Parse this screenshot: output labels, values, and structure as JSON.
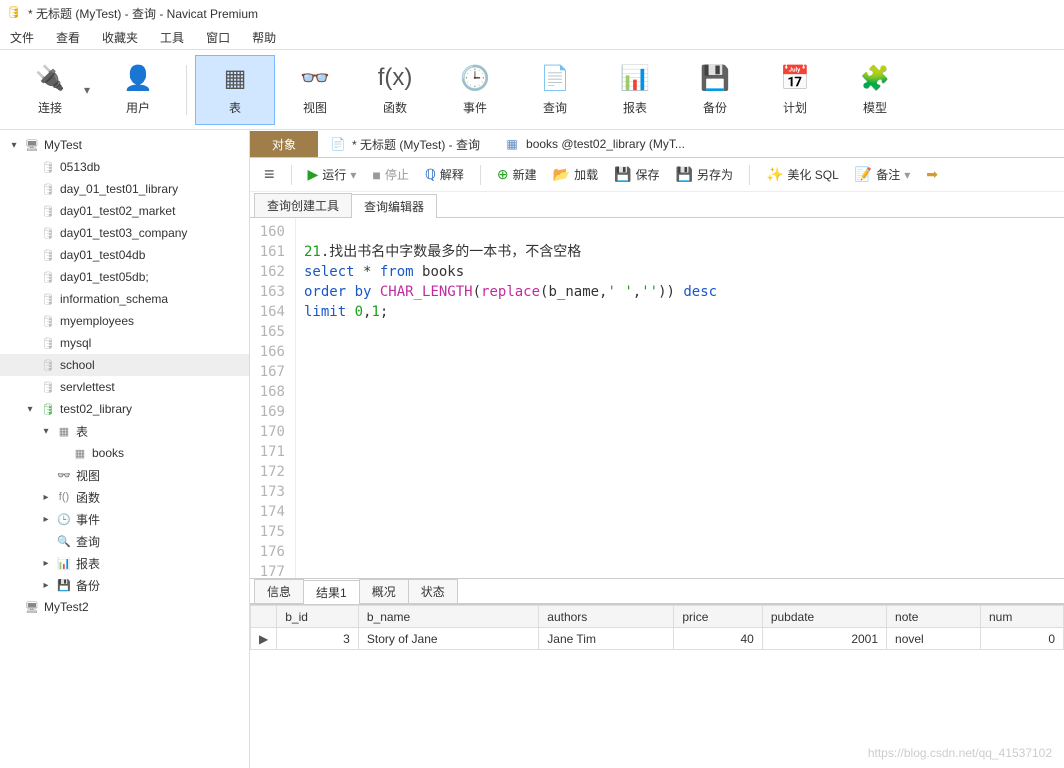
{
  "window": {
    "title": "* 无标题 (MyTest) - 查询 - Navicat Premium"
  },
  "menu": [
    "文件",
    "查看",
    "收藏夹",
    "工具",
    "窗口",
    "帮助"
  ],
  "toolbar": [
    {
      "id": "connect",
      "label": "连接",
      "glyph": "🔌"
    },
    {
      "id": "user",
      "label": "用户",
      "glyph": "👤"
    },
    {
      "id": "table",
      "label": "表",
      "glyph": "▦",
      "selected": true
    },
    {
      "id": "view",
      "label": "视图",
      "glyph": "👓"
    },
    {
      "id": "func",
      "label": "函数",
      "glyph": "f(x)"
    },
    {
      "id": "event",
      "label": "事件",
      "glyph": "🕒"
    },
    {
      "id": "query",
      "label": "查询",
      "glyph": "📄"
    },
    {
      "id": "report",
      "label": "报表",
      "glyph": "📊"
    },
    {
      "id": "backup",
      "label": "备份",
      "glyph": "💾"
    },
    {
      "id": "schedule",
      "label": "计划",
      "glyph": "📅"
    },
    {
      "id": "model",
      "label": "模型",
      "glyph": "🧩"
    }
  ],
  "tree": [
    {
      "depth": 0,
      "arrow": "▾",
      "icon": "🖥",
      "label": "MyTest",
      "cls": ""
    },
    {
      "depth": 1,
      "arrow": "",
      "icon": "db",
      "label": "0513db"
    },
    {
      "depth": 1,
      "arrow": "",
      "icon": "db",
      "label": "day_01_test01_library"
    },
    {
      "depth": 1,
      "arrow": "",
      "icon": "db",
      "label": "day01_test02_market"
    },
    {
      "depth": 1,
      "arrow": "",
      "icon": "db",
      "label": "day01_test03_company"
    },
    {
      "depth": 1,
      "arrow": "",
      "icon": "db",
      "label": "day01_test04db"
    },
    {
      "depth": 1,
      "arrow": "",
      "icon": "db",
      "label": "day01_test05db;"
    },
    {
      "depth": 1,
      "arrow": "",
      "icon": "db",
      "label": "information_schema"
    },
    {
      "depth": 1,
      "arrow": "",
      "icon": "db",
      "label": "myemployees"
    },
    {
      "depth": 1,
      "arrow": "",
      "icon": "db",
      "label": "mysql"
    },
    {
      "depth": 1,
      "arrow": "",
      "icon": "db",
      "label": "school",
      "sel": true
    },
    {
      "depth": 1,
      "arrow": "",
      "icon": "db",
      "label": "servlettest"
    },
    {
      "depth": 1,
      "arrow": "▾",
      "icon": "db-on",
      "label": "test02_library"
    },
    {
      "depth": 2,
      "arrow": "▾",
      "icon": "▦",
      "label": "表"
    },
    {
      "depth": 3,
      "arrow": "",
      "icon": "▦",
      "label": "books"
    },
    {
      "depth": 2,
      "arrow": "",
      "icon": "👓",
      "label": "视图"
    },
    {
      "depth": 2,
      "arrow": "▸",
      "icon": "f()",
      "label": "函数"
    },
    {
      "depth": 2,
      "arrow": "▸",
      "icon": "🕒",
      "label": "事件"
    },
    {
      "depth": 2,
      "arrow": "",
      "icon": "🔍",
      "label": "查询"
    },
    {
      "depth": 2,
      "arrow": "▸",
      "icon": "📊",
      "label": "报表"
    },
    {
      "depth": 2,
      "arrow": "▸",
      "icon": "💾",
      "label": "备份"
    },
    {
      "depth": 0,
      "arrow": "",
      "icon": "🖥",
      "label": "MyTest2"
    }
  ],
  "docTabs": {
    "obj": "对象",
    "query": "* 无标题 (MyTest) - 查询",
    "table": "books @test02_library (MyT..."
  },
  "queryToolbar": {
    "hamburger": "≡",
    "run": "运行",
    "stop": "停止",
    "explain": "解释",
    "new": "新建",
    "load": "加载",
    "save": "保存",
    "saveAs": "另存为",
    "beautify": "美化 SQL",
    "note": "备注"
  },
  "innerTabs": {
    "builder": "查询创建工具",
    "editor": "查询编辑器"
  },
  "code": {
    "start": 160,
    "lines": [
      "",
      "21.找出书名中字数最多的一本书，不含空格",
      "select * from books",
      "order by CHAR_LENGTH(replace(b_name,' ','')) desc",
      "limit 0,1;",
      "",
      "",
      "",
      "",
      "",
      "",
      "",
      "",
      "",
      "",
      "",
      "",
      "",
      ""
    ]
  },
  "resultTabs": {
    "info": "信息",
    "r1": "结果1",
    "profile": "概况",
    "status": "状态"
  },
  "resultCols": [
    "b_id",
    "b_name",
    "authors",
    "price",
    "pubdate",
    "note",
    "num"
  ],
  "resultRows": [
    {
      "b_id": "3",
      "b_name": "Story of Jane",
      "authors": "Jane Tim",
      "price": "40",
      "pubdate": "2001",
      "note": "novel",
      "num": "0"
    }
  ],
  "watermark": "https://blog.csdn.net/qq_41537102"
}
